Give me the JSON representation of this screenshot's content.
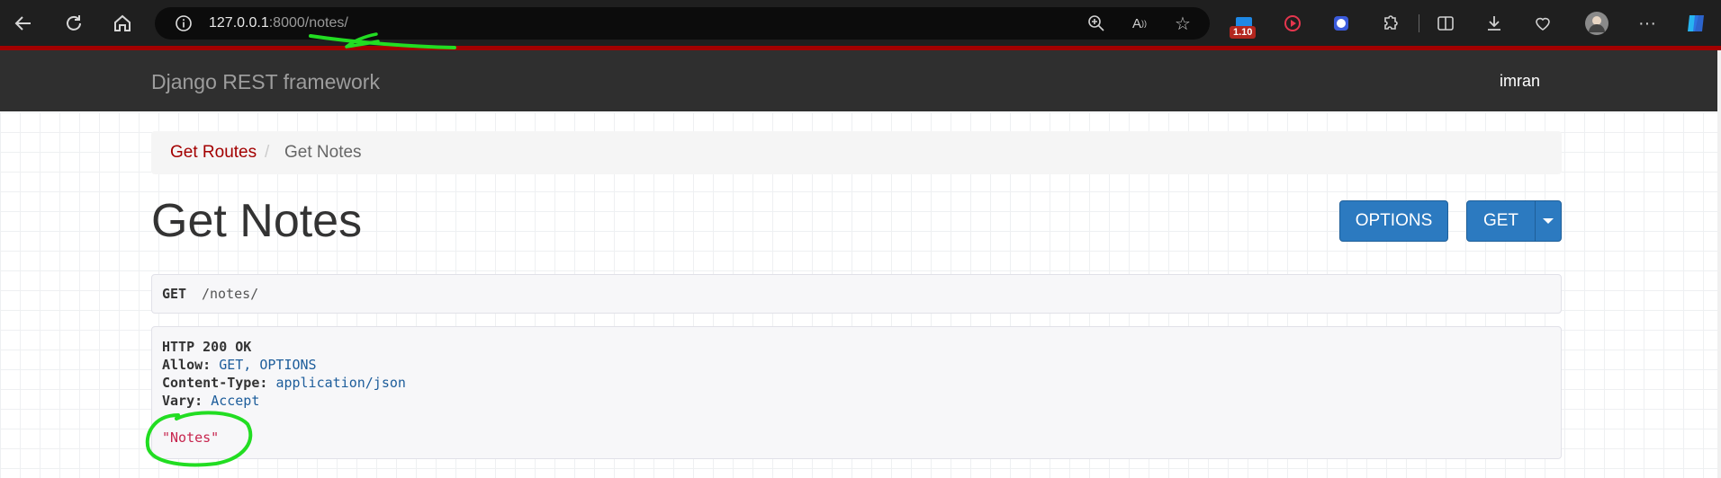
{
  "browser": {
    "url_host": "127.0.0.1",
    "url_port": ":8000",
    "url_path": "/notes/",
    "extension_badge": "1.10"
  },
  "navbar": {
    "brand": "Django REST framework",
    "user": "imran"
  },
  "breadcrumb": {
    "items": [
      "Get Routes",
      "Get Notes"
    ],
    "separator": "/"
  },
  "page": {
    "title": "Get Notes",
    "options_button": "OPTIONS",
    "get_button": "GET"
  },
  "request": {
    "method": "GET",
    "path": "/notes/"
  },
  "response": {
    "status": "HTTP 200 OK",
    "headers": [
      {
        "name": "Allow:",
        "value": "GET, OPTIONS"
      },
      {
        "name": "Content-Type:",
        "value": "application/json"
      },
      {
        "name": "Vary:",
        "value": "Accept"
      }
    ],
    "body": "\"Notes\""
  },
  "colors": {
    "accent": "#a30000",
    "button": "#2c7ac0",
    "annotation": "#22dd22"
  },
  "icons": [
    "back-icon",
    "refresh-icon",
    "home-icon",
    "info-icon",
    "zoom-icon",
    "read-aloud-icon",
    "favorite-icon",
    "extension-icon",
    "split-screen-icon",
    "download-icon",
    "browser-essentials-icon",
    "profile-avatar",
    "more-icon",
    "copilot-icon"
  ]
}
